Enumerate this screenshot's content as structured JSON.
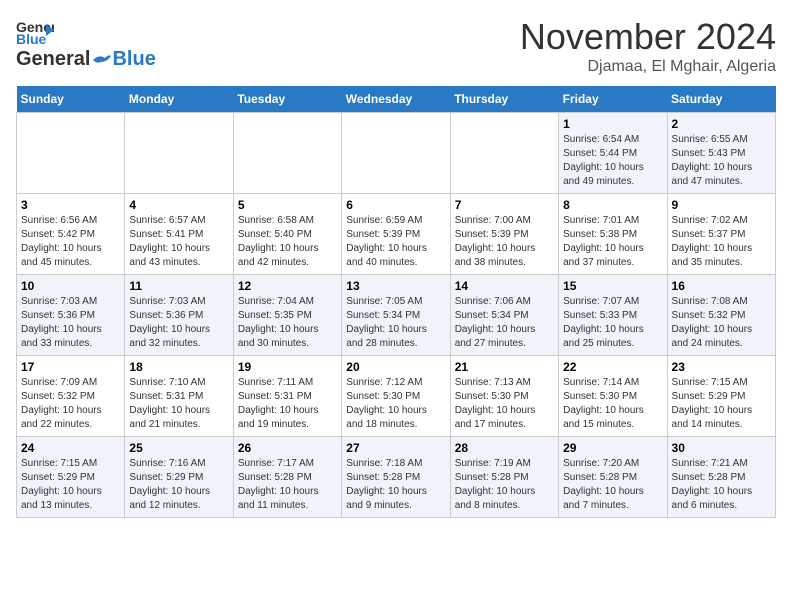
{
  "header": {
    "logo_general": "General",
    "logo_blue": "Blue",
    "month_title": "November 2024",
    "location": "Djamaa, El Mghair, Algeria"
  },
  "weekdays": [
    "Sunday",
    "Monday",
    "Tuesday",
    "Wednesday",
    "Thursday",
    "Friday",
    "Saturday"
  ],
  "weeks": [
    [
      {
        "day": "",
        "info": ""
      },
      {
        "day": "",
        "info": ""
      },
      {
        "day": "",
        "info": ""
      },
      {
        "day": "",
        "info": ""
      },
      {
        "day": "",
        "info": ""
      },
      {
        "day": "1",
        "info": "Sunrise: 6:54 AM\nSunset: 5:44 PM\nDaylight: 10 hours and 49 minutes."
      },
      {
        "day": "2",
        "info": "Sunrise: 6:55 AM\nSunset: 5:43 PM\nDaylight: 10 hours and 47 minutes."
      }
    ],
    [
      {
        "day": "3",
        "info": "Sunrise: 6:56 AM\nSunset: 5:42 PM\nDaylight: 10 hours and 45 minutes."
      },
      {
        "day": "4",
        "info": "Sunrise: 6:57 AM\nSunset: 5:41 PM\nDaylight: 10 hours and 43 minutes."
      },
      {
        "day": "5",
        "info": "Sunrise: 6:58 AM\nSunset: 5:40 PM\nDaylight: 10 hours and 42 minutes."
      },
      {
        "day": "6",
        "info": "Sunrise: 6:59 AM\nSunset: 5:39 PM\nDaylight: 10 hours and 40 minutes."
      },
      {
        "day": "7",
        "info": "Sunrise: 7:00 AM\nSunset: 5:39 PM\nDaylight: 10 hours and 38 minutes."
      },
      {
        "day": "8",
        "info": "Sunrise: 7:01 AM\nSunset: 5:38 PM\nDaylight: 10 hours and 37 minutes."
      },
      {
        "day": "9",
        "info": "Sunrise: 7:02 AM\nSunset: 5:37 PM\nDaylight: 10 hours and 35 minutes."
      }
    ],
    [
      {
        "day": "10",
        "info": "Sunrise: 7:03 AM\nSunset: 5:36 PM\nDaylight: 10 hours and 33 minutes."
      },
      {
        "day": "11",
        "info": "Sunrise: 7:03 AM\nSunset: 5:36 PM\nDaylight: 10 hours and 32 minutes."
      },
      {
        "day": "12",
        "info": "Sunrise: 7:04 AM\nSunset: 5:35 PM\nDaylight: 10 hours and 30 minutes."
      },
      {
        "day": "13",
        "info": "Sunrise: 7:05 AM\nSunset: 5:34 PM\nDaylight: 10 hours and 28 minutes."
      },
      {
        "day": "14",
        "info": "Sunrise: 7:06 AM\nSunset: 5:34 PM\nDaylight: 10 hours and 27 minutes."
      },
      {
        "day": "15",
        "info": "Sunrise: 7:07 AM\nSunset: 5:33 PM\nDaylight: 10 hours and 25 minutes."
      },
      {
        "day": "16",
        "info": "Sunrise: 7:08 AM\nSunset: 5:32 PM\nDaylight: 10 hours and 24 minutes."
      }
    ],
    [
      {
        "day": "17",
        "info": "Sunrise: 7:09 AM\nSunset: 5:32 PM\nDaylight: 10 hours and 22 minutes."
      },
      {
        "day": "18",
        "info": "Sunrise: 7:10 AM\nSunset: 5:31 PM\nDaylight: 10 hours and 21 minutes."
      },
      {
        "day": "19",
        "info": "Sunrise: 7:11 AM\nSunset: 5:31 PM\nDaylight: 10 hours and 19 minutes."
      },
      {
        "day": "20",
        "info": "Sunrise: 7:12 AM\nSunset: 5:30 PM\nDaylight: 10 hours and 18 minutes."
      },
      {
        "day": "21",
        "info": "Sunrise: 7:13 AM\nSunset: 5:30 PM\nDaylight: 10 hours and 17 minutes."
      },
      {
        "day": "22",
        "info": "Sunrise: 7:14 AM\nSunset: 5:30 PM\nDaylight: 10 hours and 15 minutes."
      },
      {
        "day": "23",
        "info": "Sunrise: 7:15 AM\nSunset: 5:29 PM\nDaylight: 10 hours and 14 minutes."
      }
    ],
    [
      {
        "day": "24",
        "info": "Sunrise: 7:15 AM\nSunset: 5:29 PM\nDaylight: 10 hours and 13 minutes."
      },
      {
        "day": "25",
        "info": "Sunrise: 7:16 AM\nSunset: 5:29 PM\nDaylight: 10 hours and 12 minutes."
      },
      {
        "day": "26",
        "info": "Sunrise: 7:17 AM\nSunset: 5:28 PM\nDaylight: 10 hours and 11 minutes."
      },
      {
        "day": "27",
        "info": "Sunrise: 7:18 AM\nSunset: 5:28 PM\nDaylight: 10 hours and 9 minutes."
      },
      {
        "day": "28",
        "info": "Sunrise: 7:19 AM\nSunset: 5:28 PM\nDaylight: 10 hours and 8 minutes."
      },
      {
        "day": "29",
        "info": "Sunrise: 7:20 AM\nSunset: 5:28 PM\nDaylight: 10 hours and 7 minutes."
      },
      {
        "day": "30",
        "info": "Sunrise: 7:21 AM\nSunset: 5:28 PM\nDaylight: 10 hours and 6 minutes."
      }
    ]
  ]
}
